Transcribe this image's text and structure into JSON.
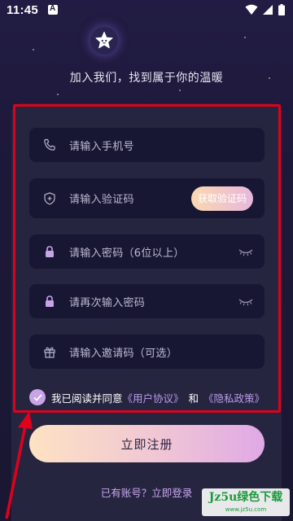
{
  "status_bar": {
    "time": "11:45"
  },
  "header": {
    "tagline": "加入我们，找到属于你的温暖"
  },
  "form": {
    "phone_placeholder": "请输入手机号",
    "code_placeholder": "请输入验证码",
    "get_code_label": "获取验证码",
    "password_placeholder": "请输入密码（6位以上）",
    "confirm_password_placeholder": "请再次输入密码",
    "invite_placeholder": "请输入邀请码（可选）"
  },
  "agreement": {
    "prefix": "我已阅读并同意",
    "user_agreement": "《用户协议》",
    "and": "和",
    "privacy_policy": "《隐私政策》",
    "checked": true
  },
  "actions": {
    "register_label": "立即注册",
    "login_link": "已有账号？立即登录"
  },
  "watermark": {
    "line1": "Jz5u绿色下载",
    "line2": "www.jz5u.com"
  },
  "colors": {
    "background": "#1c1838",
    "card": "#262540",
    "field": "#181733",
    "accent_purple": "#b99ae8",
    "highlight_red": "#e0001b"
  }
}
